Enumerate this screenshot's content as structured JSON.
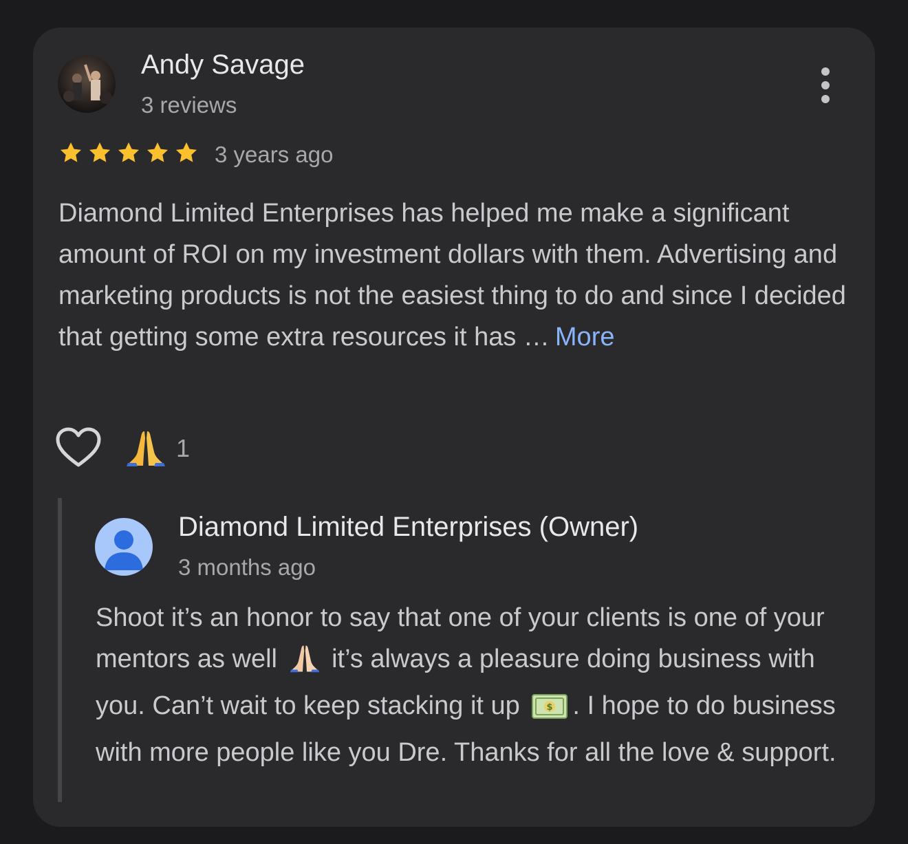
{
  "review": {
    "reviewer_name": "Andy Savage",
    "reviewer_reviews": "3 reviews",
    "rating": 5,
    "rating_max": 5,
    "age": "3 years ago",
    "text": "Diamond Limited Enterprises has helped me make a significant amount of ROI on my investment dollars with them. Advertising and marketing products is not the easiest thing to do and since I decided that getting some extra resources it has …",
    "more_label": "More",
    "reaction_count": "1",
    "icons": {
      "menu": "more-vert-icon",
      "like": "heart-outline-icon",
      "reaction": "praying-hands-emoji",
      "star": "star-icon"
    },
    "colors": {
      "star": "#fbc02d",
      "link": "#8ab4f8"
    }
  },
  "owner_reply": {
    "name": "Diamond Limited Enterprises (Owner)",
    "age": "3 months ago",
    "text_parts": {
      "part1": "Shoot it’s an honor to say that one of your clients is one of your mentors as well",
      "part2": "it’s always a pleasure doing business with you. Can’t wait to keep stacking it up",
      "part3": ". I hope to do business with more people like you Dre. Thanks for all the love & support."
    },
    "emoji": [
      "praying-hands-emoji",
      "dollar-banknote-emoji"
    ],
    "avatar_icon": "default-person-avatar-icon"
  }
}
